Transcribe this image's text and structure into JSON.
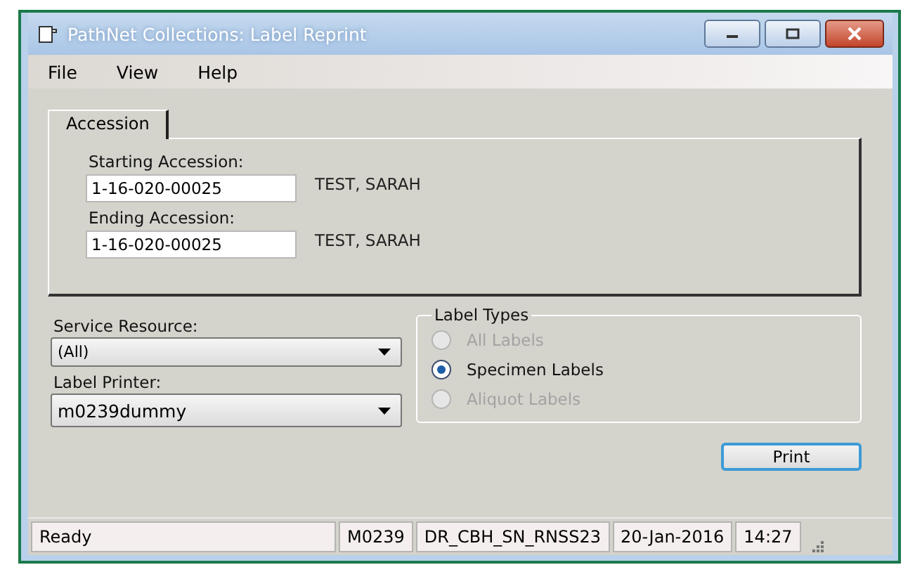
{
  "window": {
    "title": "PathNet Collections: Label Reprint"
  },
  "menu": [
    {
      "label": "File"
    },
    {
      "label": "View"
    },
    {
      "label": "Help"
    }
  ],
  "tabs": [
    {
      "label": "Accession",
      "selected": true
    }
  ],
  "accession": [
    {
      "label": "Starting Accession:",
      "value": "1-16-020-00025",
      "name": "TEST, SARAH"
    },
    {
      "label": "Ending Accession:",
      "value": "1-16-020-00025",
      "name": "TEST, SARAH"
    }
  ],
  "dropdowns": [
    {
      "label": "Service Resource:",
      "value": "(All)"
    },
    {
      "label": "Label Printer:",
      "value": "m0239dummy"
    }
  ],
  "label_types": {
    "title": "Label Types",
    "options": [
      {
        "label": "All Labels",
        "selected": false,
        "disabled": true
      },
      {
        "label": "Specimen Labels",
        "selected": true,
        "disabled": false
      },
      {
        "label": "Aliquot Labels",
        "selected": false,
        "disabled": true
      }
    ]
  },
  "buttons": [
    {
      "label": "Print"
    }
  ],
  "status_bar": [
    "Ready",
    "M0239",
    "DR_CBH_SN_RNSS23",
    "20-Jan-2016",
    "14:27"
  ]
}
